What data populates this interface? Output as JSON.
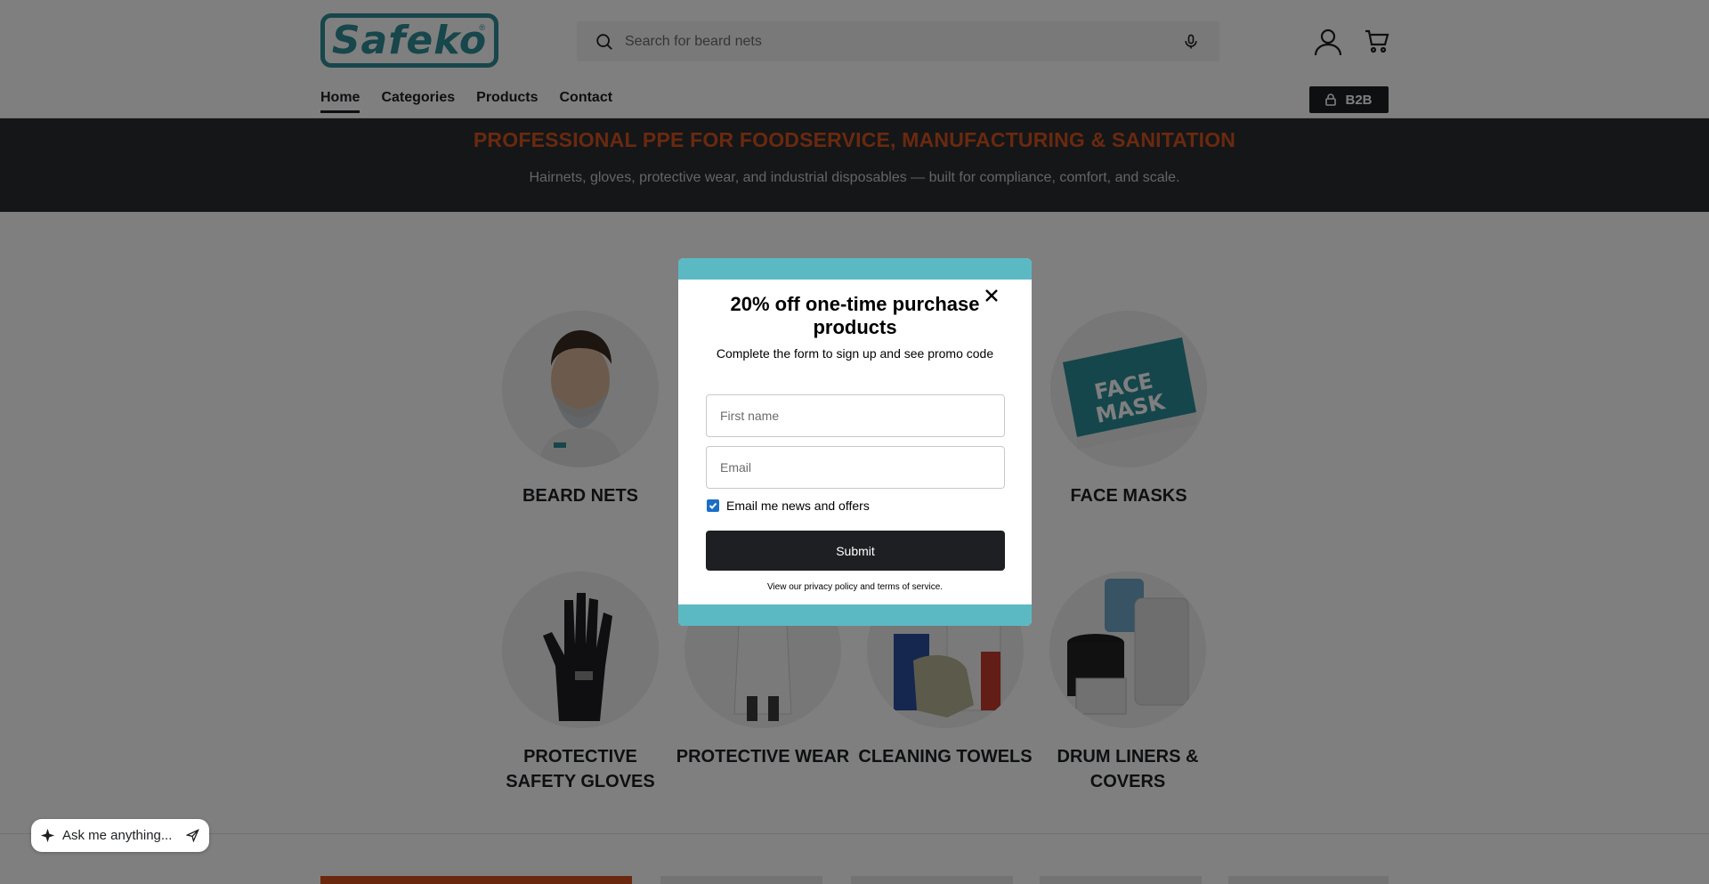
{
  "header": {
    "logo_text": "Safeko",
    "logo_mark": "®",
    "search": {
      "placeholder": "Search for beard nets"
    },
    "icons": [
      "search-icon",
      "microphone-icon",
      "account-icon",
      "cart-icon"
    ],
    "b2b_label": "B2B"
  },
  "nav": {
    "items": [
      "Home",
      "Categories",
      "Products",
      "Contact"
    ],
    "active": "Home"
  },
  "hero": {
    "title": "PROFESSIONAL PPE FOR FOODSERVICE, MANUFACTURING & SANITATION",
    "subtitle": "Hairnets, gloves, protective wear, and industrial disposables — built for compliance, comfort, and scale."
  },
  "categories": [
    {
      "label": "BEARD NETS"
    },
    {
      "label": "FACE MASKS"
    },
    {
      "label": "PROTECTIVE SAFETY GLOVES"
    },
    {
      "label": "PROTECTIVE WEAR"
    },
    {
      "label": "CLEANING TOWELS"
    },
    {
      "label": "DRUM LINERS & COVERS"
    }
  ],
  "modal": {
    "title": "20% off one-time purchase products",
    "subtitle": "Complete the form to sign up and see promo code",
    "first_name_placeholder": "First name",
    "email_placeholder": "Email",
    "consent_label": "Email me news and offers",
    "consent_checked": true,
    "submit_label": "Submit",
    "policy_text": "View our privacy policy and terms of service."
  },
  "chat": {
    "label": "Ask me anything..."
  },
  "colors": {
    "brand_teal": "#2f8c96",
    "accent_orange": "#d4531f",
    "modal_band": "#5bb9c3",
    "dark": "#1d1f22"
  }
}
